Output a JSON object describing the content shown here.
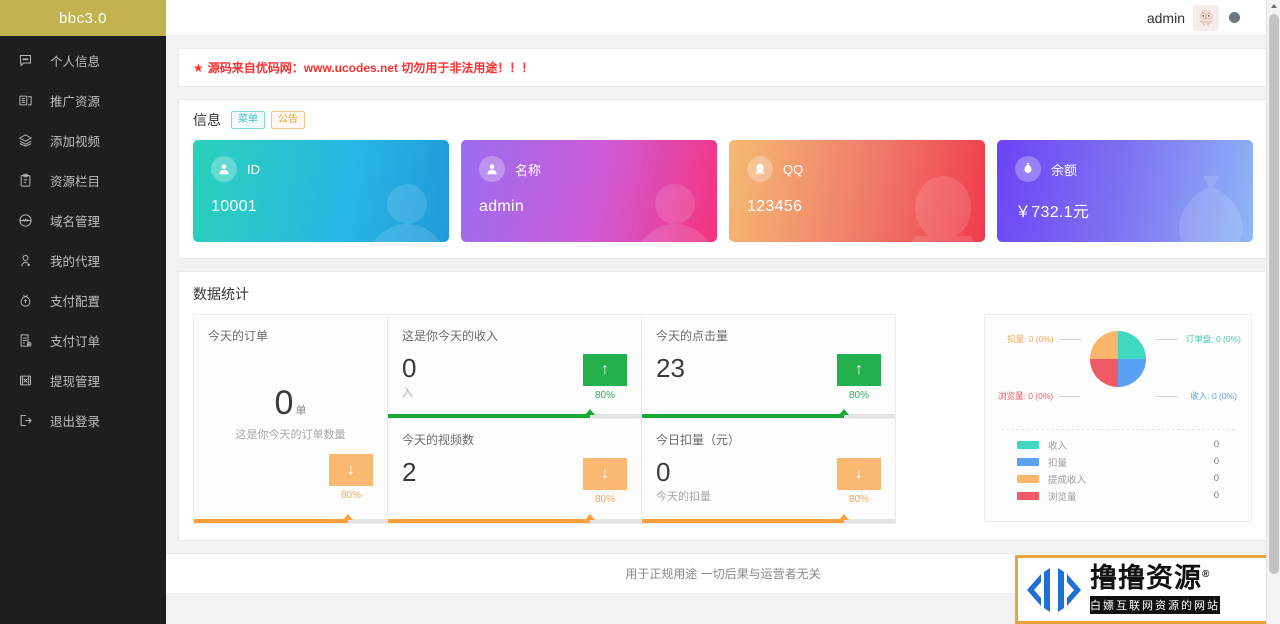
{
  "sidebar": {
    "logo": "bbc3.0",
    "items": [
      {
        "label": "个人信息",
        "icon": "message-icon"
      },
      {
        "label": "推广资源",
        "icon": "archive-icon"
      },
      {
        "label": "添加视频",
        "icon": "layers-icon"
      },
      {
        "label": "资源栏目",
        "icon": "clipboard-icon"
      },
      {
        "label": "域名管理",
        "icon": "globe-icon"
      },
      {
        "label": "我的代理",
        "icon": "user-icon"
      },
      {
        "label": "支付配置",
        "icon": "money-bag-icon"
      },
      {
        "label": "支付订单",
        "icon": "invoice-icon"
      },
      {
        "label": "提现管理",
        "icon": "withdraw-icon"
      },
      {
        "label": "退出登录",
        "icon": "logout-icon"
      }
    ]
  },
  "topbar": {
    "user": "admin",
    "avatar_icon": "owl-avatar",
    "menu_icon": "dropdown-dot-icon"
  },
  "notice": {
    "star": "★",
    "prefix": "源码来自优码网：",
    "link": "www.ucodes.net",
    "suffix": " 切勿用于非法用途！！！"
  },
  "info_panel": {
    "title": "信息",
    "tags": [
      {
        "label": "菜单",
        "color": "#3fc4c4"
      },
      {
        "label": "公告",
        "color": "#e8a33d"
      }
    ],
    "cards": [
      {
        "label": "ID",
        "value": "10001",
        "icon": "user-icon",
        "theme": "card-id"
      },
      {
        "label": "名称",
        "value": "admin",
        "icon": "user-icon",
        "theme": "card-name"
      },
      {
        "label": "QQ",
        "value": "123456",
        "icon": "penguin-icon",
        "theme": "card-qq"
      },
      {
        "label": "余额",
        "value": "￥732.1元",
        "icon": "money-bag-icon",
        "theme": "card-bal"
      }
    ]
  },
  "stats": {
    "title": "数据统计",
    "orders": {
      "title": "今天的订单",
      "value": "0",
      "unit": "单",
      "sub": "这是你今天的订单数量",
      "arrow": "↓",
      "percent": "80%",
      "trend": "down"
    },
    "income": {
      "title": "这是你今天的收入",
      "value": "0",
      "sub": "入",
      "arrow": "↑",
      "percent": "80%",
      "trend": "up"
    },
    "videos": {
      "title": "今天的视频数",
      "value": "2",
      "sub": "",
      "arrow": "↓",
      "percent": "80%",
      "trend": "down"
    },
    "clicks": {
      "title": "今天的点击量",
      "value": "23",
      "sub": "",
      "arrow": "↑",
      "percent": "80%",
      "trend": "up"
    },
    "deduct": {
      "title": "今日扣量（元）",
      "value": "0",
      "sub": "今天的扣量",
      "arrow": "↓",
      "percent": "80%",
      "trend": "down"
    }
  },
  "chart_data": {
    "type": "pie",
    "title": "",
    "categories": [
      "订单量",
      "收入",
      "浏览量",
      "扣量"
    ],
    "values": [
      0,
      0,
      0,
      0
    ],
    "percents": [
      "0%",
      "0%",
      "0%",
      "0%"
    ],
    "slice_colors": [
      "#41d8c0",
      "#5aa0f5",
      "#ef5a66",
      "#fcb56a"
    ],
    "callout_labels": [
      {
        "text": "扣量: 0 (0%)",
        "color": "#f0a95c"
      },
      {
        "text": "订单盘: 0 (0%)",
        "color": "#3fcbb5"
      },
      {
        "text": "浏览量: 0 (0%)",
        "color": "#ee5a66"
      },
      {
        "text": "收入: 0 (0%)",
        "color": "#5aa0f5"
      }
    ],
    "legend_position": "bottom",
    "legend": [
      {
        "name": "收入",
        "value": "0",
        "color": "#41d8c0"
      },
      {
        "name": "扣量",
        "value": "0",
        "color": "#5aa0f5"
      },
      {
        "name": "提成收入",
        "value": "0",
        "color": "#fcb56a"
      },
      {
        "name": "浏览量",
        "value": "0",
        "color": "#ef5a66"
      }
    ]
  },
  "footer": {
    "text": "用于正规用途 一切后果与运营者无关"
  },
  "watermark": {
    "title": "撸撸资源",
    "registered": "®",
    "subtitle": "白嫖互联网资源的网站",
    "border_color": "#e8a33d",
    "mark_color": "#1f6fd4"
  }
}
